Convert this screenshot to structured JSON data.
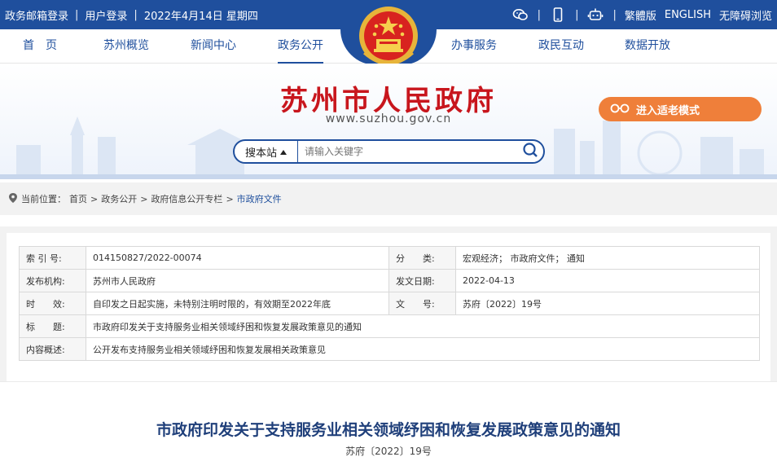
{
  "topbar": {
    "mail_login": "政务邮箱登录",
    "user_login": "用户登录",
    "date": "2022年4月14日 星期四",
    "sep": "|",
    "traditional": "繁體版",
    "english": "ENGLISH",
    "accessibility": "无障碍浏览",
    "icons": [
      "wechat-icon",
      "mobile-icon",
      "robot-icon"
    ]
  },
  "nav": {
    "items": [
      "首　页",
      "苏州概览",
      "新闻中心",
      "政务公开",
      "办事服务",
      "政民互动",
      "数据开放"
    ],
    "active": "政务公开"
  },
  "banner": {
    "title": "苏州市人民政府",
    "url": "www.suzhou.gov.cn",
    "elder_mode": "进入适老模式"
  },
  "search": {
    "scope": "搜本站",
    "placeholder": "请输入关键字"
  },
  "breadcrumb": {
    "label": "当前位置：",
    "items": [
      "首页",
      "政务公开",
      "政府信息公开专栏",
      "市政府文件"
    ],
    "separator": ">"
  },
  "info": {
    "index_label": "索 引 号:",
    "index_value": "014150827/2022-00074",
    "category_label": "分　　类:",
    "category_value": "宏观经济；  市政府文件；  通知",
    "org_label": "发布机构:",
    "org_value": "苏州市人民政府",
    "date_label": "发文日期:",
    "date_value": "2022-04-13",
    "validity_label": "时　　效:",
    "validity_value": "自印发之日起实施，未特别注明时限的，有效期至2022年底",
    "docno_label": "文　　号:",
    "docno_value": "苏府〔2022〕19号",
    "title_label": "标　　题:",
    "title_value": "市政府印发关于支持服务业相关领域纾困和恢复发展政策意见的通知",
    "summary_label": "内容概述:",
    "summary_value": "公开发布支持服务业相关领域纾困和恢复发展相关政策意见"
  },
  "article": {
    "title": "市政府印发关于支持服务业相关领域纾困和恢复发展政策意见的通知",
    "doc_no": "苏府〔2022〕19号"
  },
  "colors": {
    "brand_blue": "#1f4f9d",
    "title_red": "#c8161d",
    "elder_orange": "#ef7f3a"
  }
}
